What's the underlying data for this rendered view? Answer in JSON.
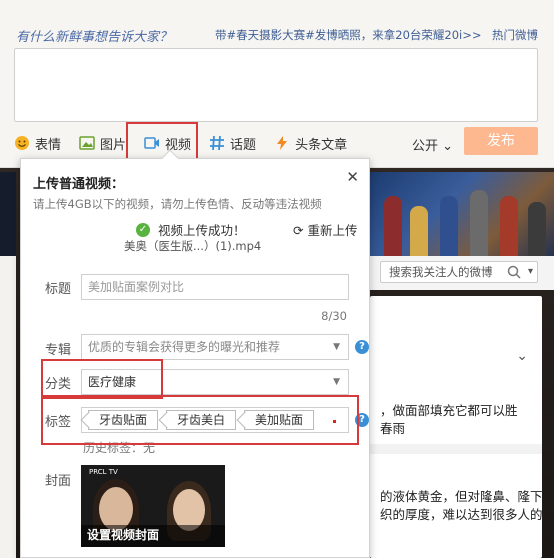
{
  "composer": {
    "prompt": "有什么新鲜事想告诉大家？",
    "topic": "带#春天摄影大赛#发博晒照，来拿20台荣耀20i>>",
    "hot": "热门微博",
    "tools": [
      {
        "label": "表情",
        "icon": "smiley-icon"
      },
      {
        "label": "图片",
        "icon": "image-icon"
      },
      {
        "label": "视频",
        "icon": "video-icon"
      },
      {
        "label": "话题",
        "icon": "hash-icon"
      },
      {
        "label": "头条文章",
        "icon": "lightning-icon"
      }
    ],
    "public": "公开",
    "publish": "发布"
  },
  "popup": {
    "title": "上传普通视频：",
    "limit": "请上传4GB以下的视频，请勿上传色情、反动等违法视频",
    "success": "视频上传成功！",
    "reupload": "重新上传",
    "filename": "美奥（医生版...）(1).mp4",
    "title_label": "标题",
    "title_value": "美加贴面案例对比",
    "counter": "8/30",
    "album_label": "专辑",
    "album_placeholder": "优质的专辑会获得更多的曝光和推荐",
    "category_label": "分类",
    "category_value": "医疗健康",
    "tags_label": "标签",
    "tags": [
      "牙齿贴面",
      "牙齿美白",
      "美加贴面"
    ],
    "history": "历史标签：无",
    "cover_label": "封面",
    "cover_text": "设置视频封面",
    "cover_header": "PRCL TV"
  },
  "side": {
    "search_placeholder": "搜索我关注人的微博",
    "lines": [
      "，做面部填充它都可以胜",
      "春雨",
      "的液体黄金，但对隆鼻、隆下",
      "织的厚度，难以达到很多人的"
    ]
  },
  "colors": {
    "highlight": "#d63a3a",
    "publish": "#fdb88f",
    "link": "#3f5f95"
  }
}
